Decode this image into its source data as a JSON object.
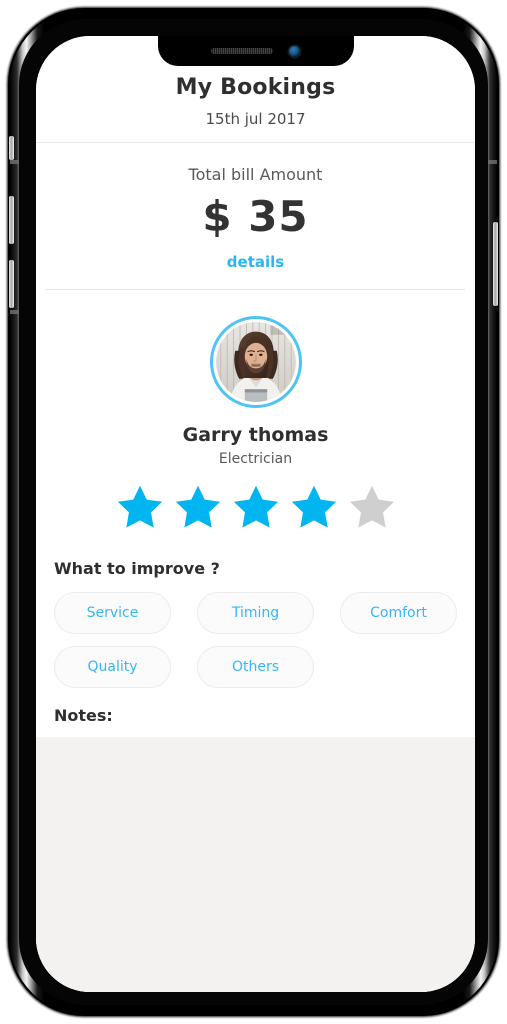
{
  "device": {
    "notch": {
      "speaker_name": "earpiece-speaker",
      "camera_name": "front-camera"
    },
    "buttons": [
      {
        "name": "silence-switch",
        "side": "left"
      },
      {
        "name": "volume-up-button",
        "side": "left"
      },
      {
        "name": "volume-down-button",
        "side": "left"
      },
      {
        "name": "power-button",
        "side": "right"
      }
    ]
  },
  "header": {
    "title": "My Bookings",
    "date": "15th jul 2017"
  },
  "bill": {
    "label": "Total bill Amount",
    "amount": "$ 35",
    "currency": "$",
    "value": "35",
    "details_link": "details"
  },
  "provider": {
    "name": "Garry thomas",
    "role": "Electrician",
    "avatar_alt": "man-with-long-hair-and-beard-in-white-tshirt",
    "rating": 4,
    "max_rating": 5
  },
  "improve": {
    "title": "What to improve ?",
    "chips": [
      {
        "label": "Service"
      },
      {
        "label": "Timing"
      },
      {
        "label": "Comfort"
      },
      {
        "label": "Quality"
      },
      {
        "label": "Others"
      }
    ]
  },
  "notes": {
    "label": "Notes:",
    "value": "",
    "placeholder": ""
  },
  "colors": {
    "accent": "#29b6f6",
    "star_filled": "#00b5f0",
    "star_empty": "#cfcfcf",
    "avatar_ring": "#4ec3f5",
    "chip_text": "#36b7f5",
    "chip_border": "#ececec",
    "chip_bg": "#fbfbfb",
    "notes_bg": "#f3f2f0",
    "text_primary": "#2f2f2f",
    "text_secondary": "#5a5a5a",
    "divider": "#e9e9e9"
  }
}
